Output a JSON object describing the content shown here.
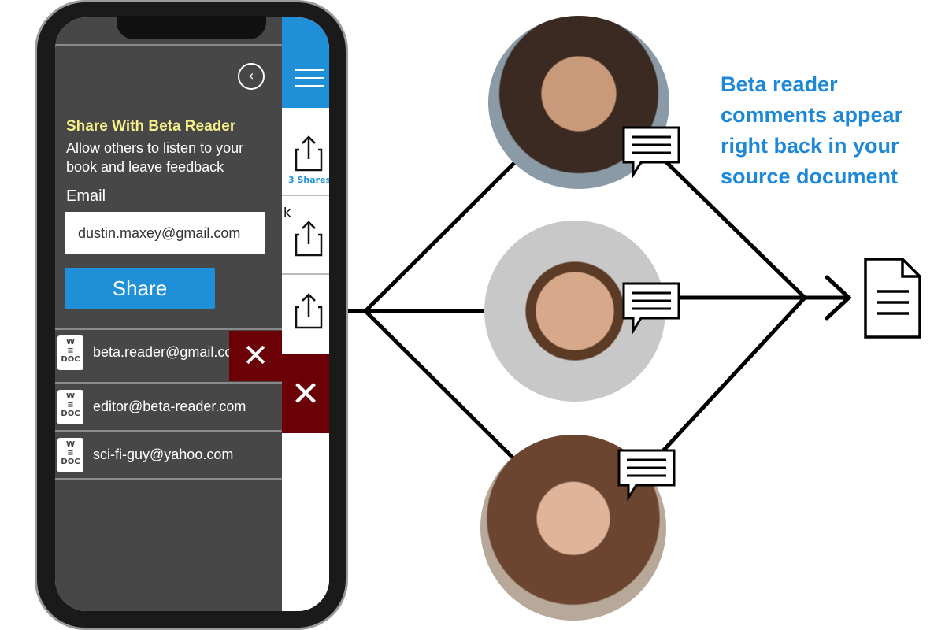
{
  "panel": {
    "title": "Share With Beta Reader",
    "description": "Allow others to listen to your book and leave feedback",
    "email_label": "Email",
    "email_value": "dustin.maxey@gmail.com",
    "share_button": "Share",
    "readers": [
      {
        "email": "beta.reader@gmail.com",
        "icon": "word-doc-icon"
      },
      {
        "email": "editor@beta-reader.com",
        "icon": "word-doc-icon"
      },
      {
        "email": "sci-fi-guy@yahoo.com",
        "icon": "word-doc-icon"
      }
    ],
    "doc_icon_top": "W",
    "doc_icon_bottom": "DOC"
  },
  "strip": {
    "shares_label": "3 Shares",
    "partial_text": "k"
  },
  "diagram": {
    "note": "Beta reader comments appear right back in your source document"
  },
  "colors": {
    "accent": "#1f90d8",
    "title": "#f7f08a",
    "panel": "#474747",
    "delete": "#6b0007",
    "note": "#1e88d8"
  }
}
